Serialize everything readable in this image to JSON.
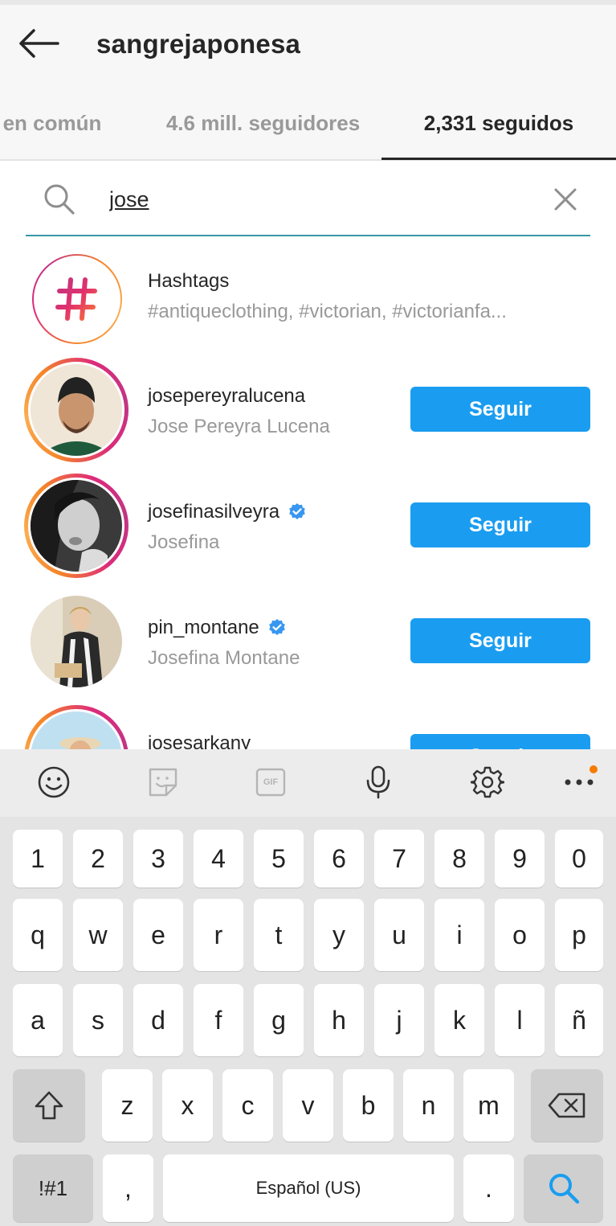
{
  "header": {
    "title": "sangrejaponesa",
    "tabs": [
      {
        "label": "en común"
      },
      {
        "label": "4.6 mill. seguidores"
      },
      {
        "label": "2,331 seguidos",
        "active": true
      }
    ]
  },
  "search": {
    "query": "jose"
  },
  "hashtags": {
    "title": "Hashtags",
    "tags": "#antiqueclothing, #victorian, #victorianfa..."
  },
  "results": [
    {
      "username": "josepereyralucena",
      "full_name": "Jose Pereyra Lucena",
      "verified": false,
      "button": "Seguir"
    },
    {
      "username": "josefinasilveyra",
      "full_name": "Josefina",
      "verified": true,
      "button": "Seguir"
    },
    {
      "username": "pin_montane",
      "full_name": "Josefina Montane",
      "verified": true,
      "button": "Seguir"
    },
    {
      "username": "josesarkany",
      "full_name": "",
      "verified": false,
      "button": "Seguir"
    }
  ],
  "keyboard": {
    "toolbar": [
      "smiley-icon",
      "sticker-icon",
      "gif-icon",
      "microphone-icon",
      "settings-icon",
      "more-icon"
    ],
    "gif_label": "GIF",
    "row_numbers": [
      "1",
      "2",
      "3",
      "4",
      "5",
      "6",
      "7",
      "8",
      "9",
      "0"
    ],
    "row1": [
      "q",
      "w",
      "e",
      "r",
      "t",
      "y",
      "u",
      "i",
      "o",
      "p"
    ],
    "row2": [
      "a",
      "s",
      "d",
      "f",
      "g",
      "h",
      "j",
      "k",
      "l",
      "ñ"
    ],
    "row3": [
      "z",
      "x",
      "c",
      "v",
      "b",
      "n",
      "m"
    ],
    "symbols_label": "!#1",
    "comma": ",",
    "space_label": "Español (US)",
    "period": ".",
    "accent_color": "#1a9df0"
  }
}
